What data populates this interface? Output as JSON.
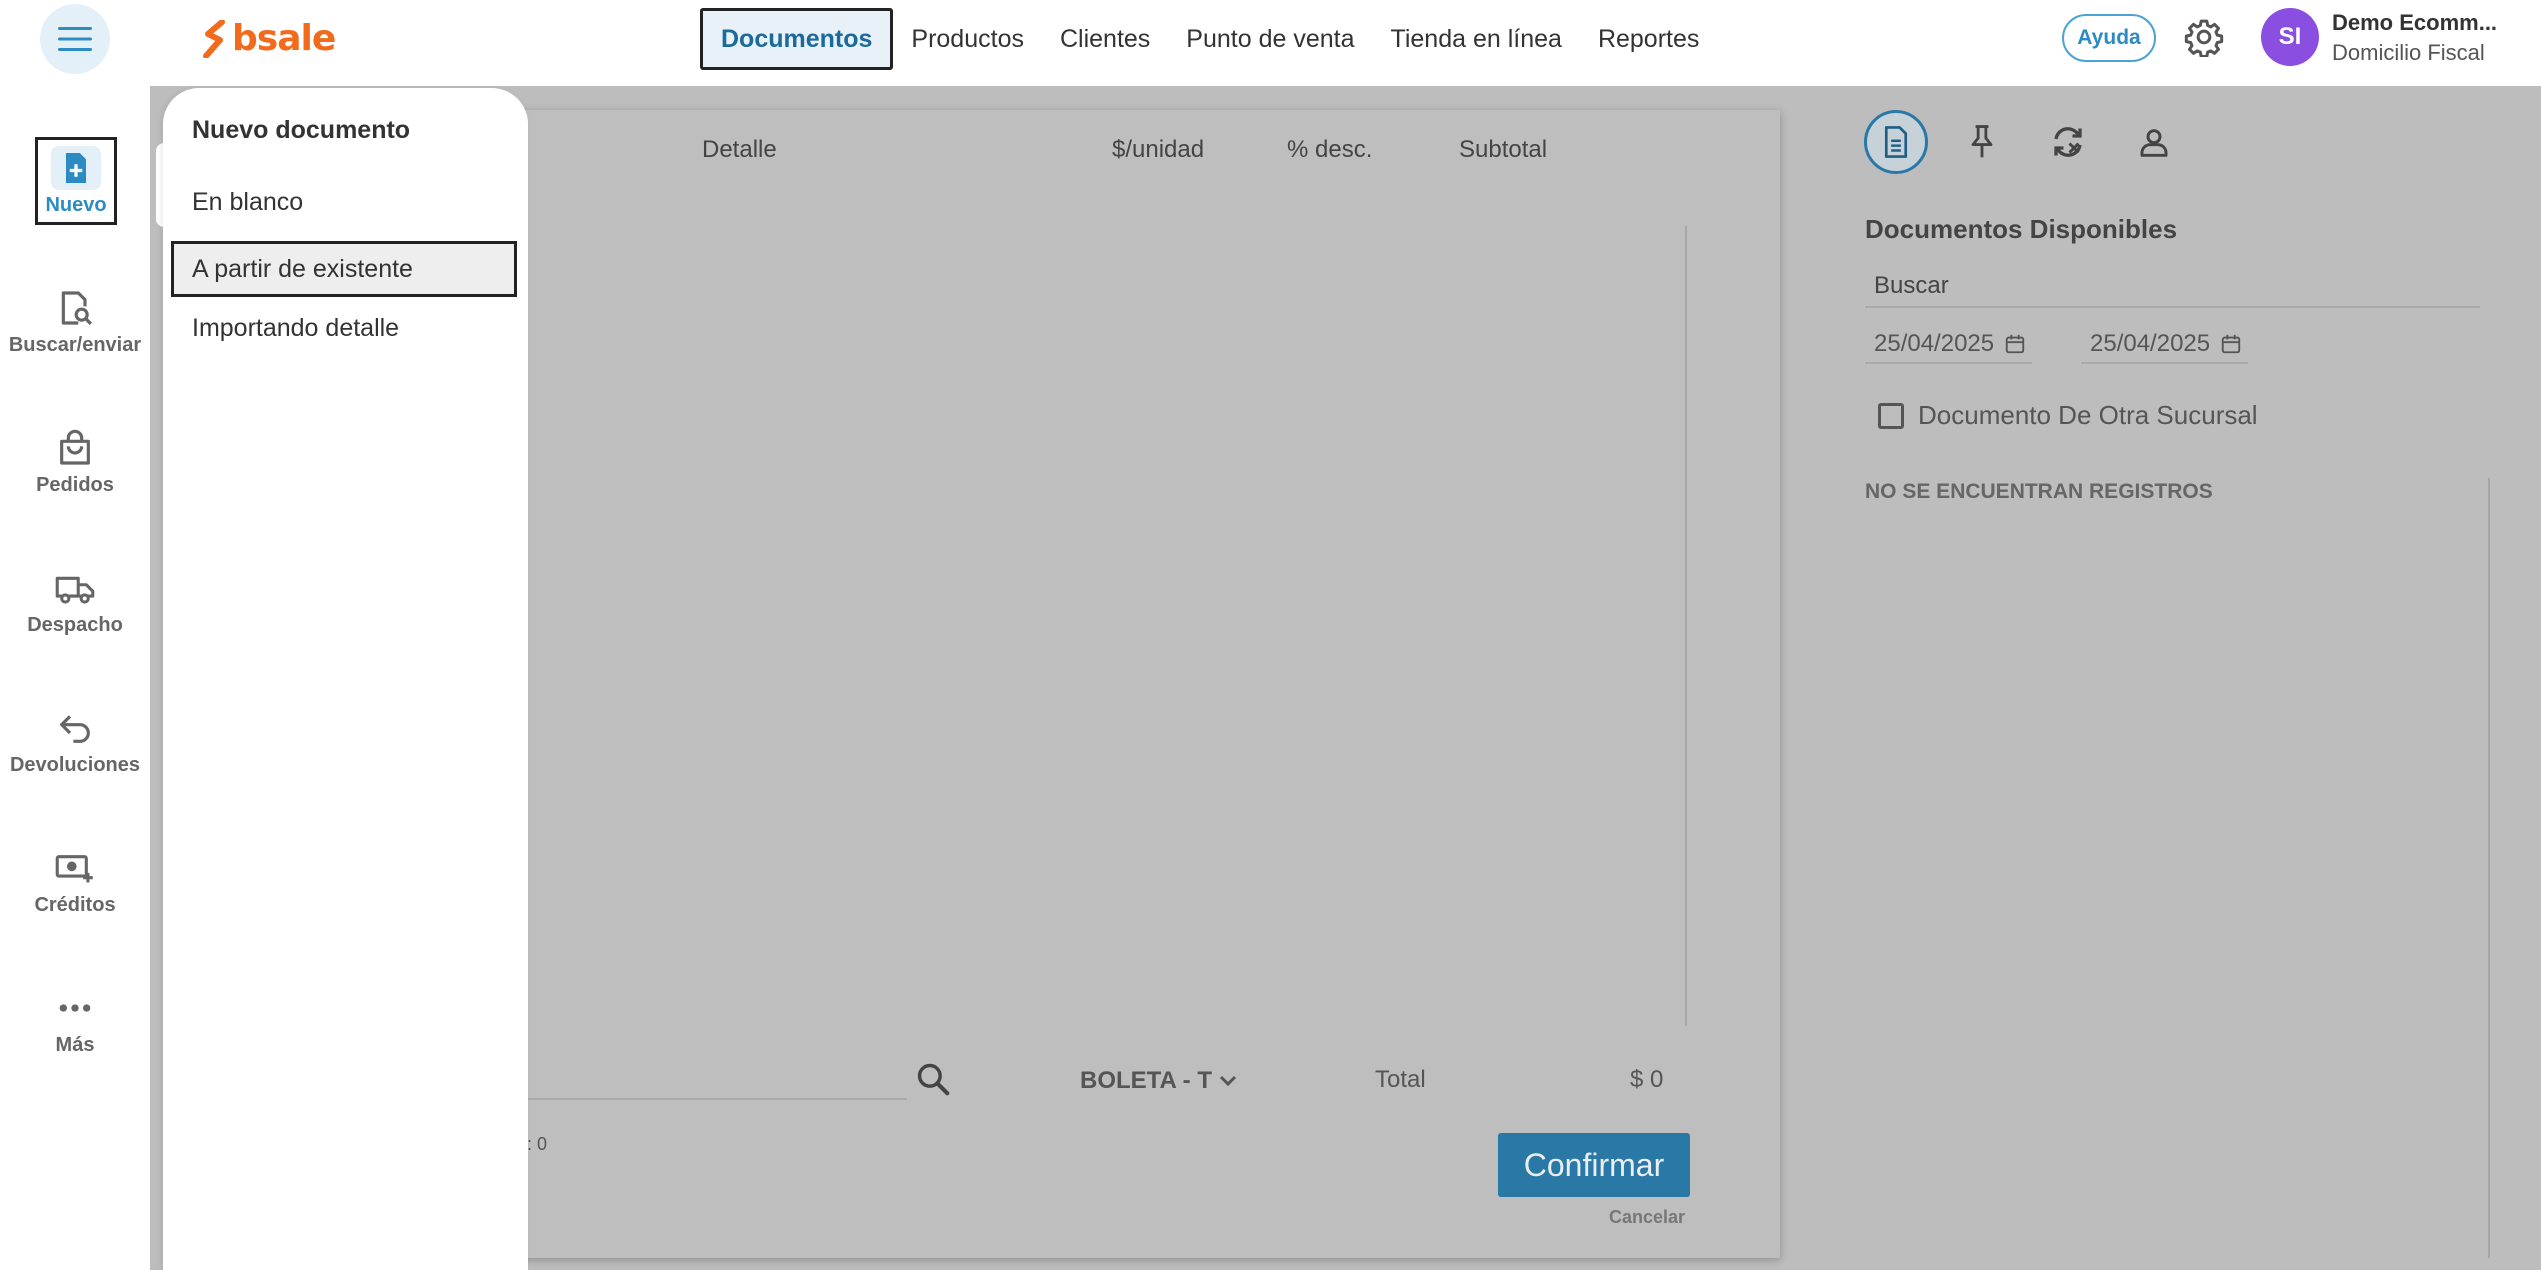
{
  "app": {
    "logo_text": "bsale",
    "brand_color": "#f26a1b",
    "accent_color": "#2d8bc4"
  },
  "topnav": {
    "items": [
      {
        "label": "Documentos",
        "active": true
      },
      {
        "label": "Productos",
        "active": false
      },
      {
        "label": "Clientes",
        "active": false
      },
      {
        "label": "Punto de venta",
        "active": false
      },
      {
        "label": "Tienda en línea",
        "active": false
      },
      {
        "label": "Reportes",
        "active": false
      }
    ],
    "help_label": "Ayuda",
    "settings_icon": "gear-icon"
  },
  "user": {
    "initials": "SI",
    "name": "Demo Ecomm...",
    "subtitle": "Domicilio Fiscal",
    "avatar_color": "#8a4fe0"
  },
  "sidebar": {
    "items": [
      {
        "label": "Nuevo",
        "icon": "new-document-icon",
        "active": true
      },
      {
        "label": "Buscar/enviar",
        "icon": "document-search-icon"
      },
      {
        "label": "Pedidos",
        "icon": "shopping-bag-icon"
      },
      {
        "label": "Despacho",
        "icon": "truck-icon"
      },
      {
        "label": "Devoluciones",
        "icon": "return-arrow-icon"
      },
      {
        "label": "Créditos",
        "icon": "money-credit-icon"
      },
      {
        "label": "Más",
        "icon": "more-dots-icon"
      }
    ]
  },
  "dropdown": {
    "title": "Nuevo documento",
    "options": [
      {
        "label": "En blanco"
      },
      {
        "label": "A partir de existente",
        "selected": true
      },
      {
        "label": "Importando detalle"
      }
    ]
  },
  "document": {
    "columns": [
      "Detalle",
      "$/unidad",
      "% desc.",
      "Subtotal"
    ],
    "doc_type": "BOLETA - T",
    "total_label": "Total",
    "total_value": "$ 0",
    "count_label": ": 0",
    "confirm_label": "Confirmar",
    "cancel_label": "Cancelar"
  },
  "right_panel": {
    "icons": [
      "document-icon",
      "pin-icon",
      "sync-off-icon",
      "person-icon"
    ],
    "title": "Documentos Disponibles",
    "search_placeholder": "Buscar",
    "date_from": "25/04/2025",
    "date_to": "25/04/2025",
    "checkbox_label": "Documento De Otra Sucursal",
    "empty_message": "NO SE ENCUENTRAN REGISTROS"
  }
}
